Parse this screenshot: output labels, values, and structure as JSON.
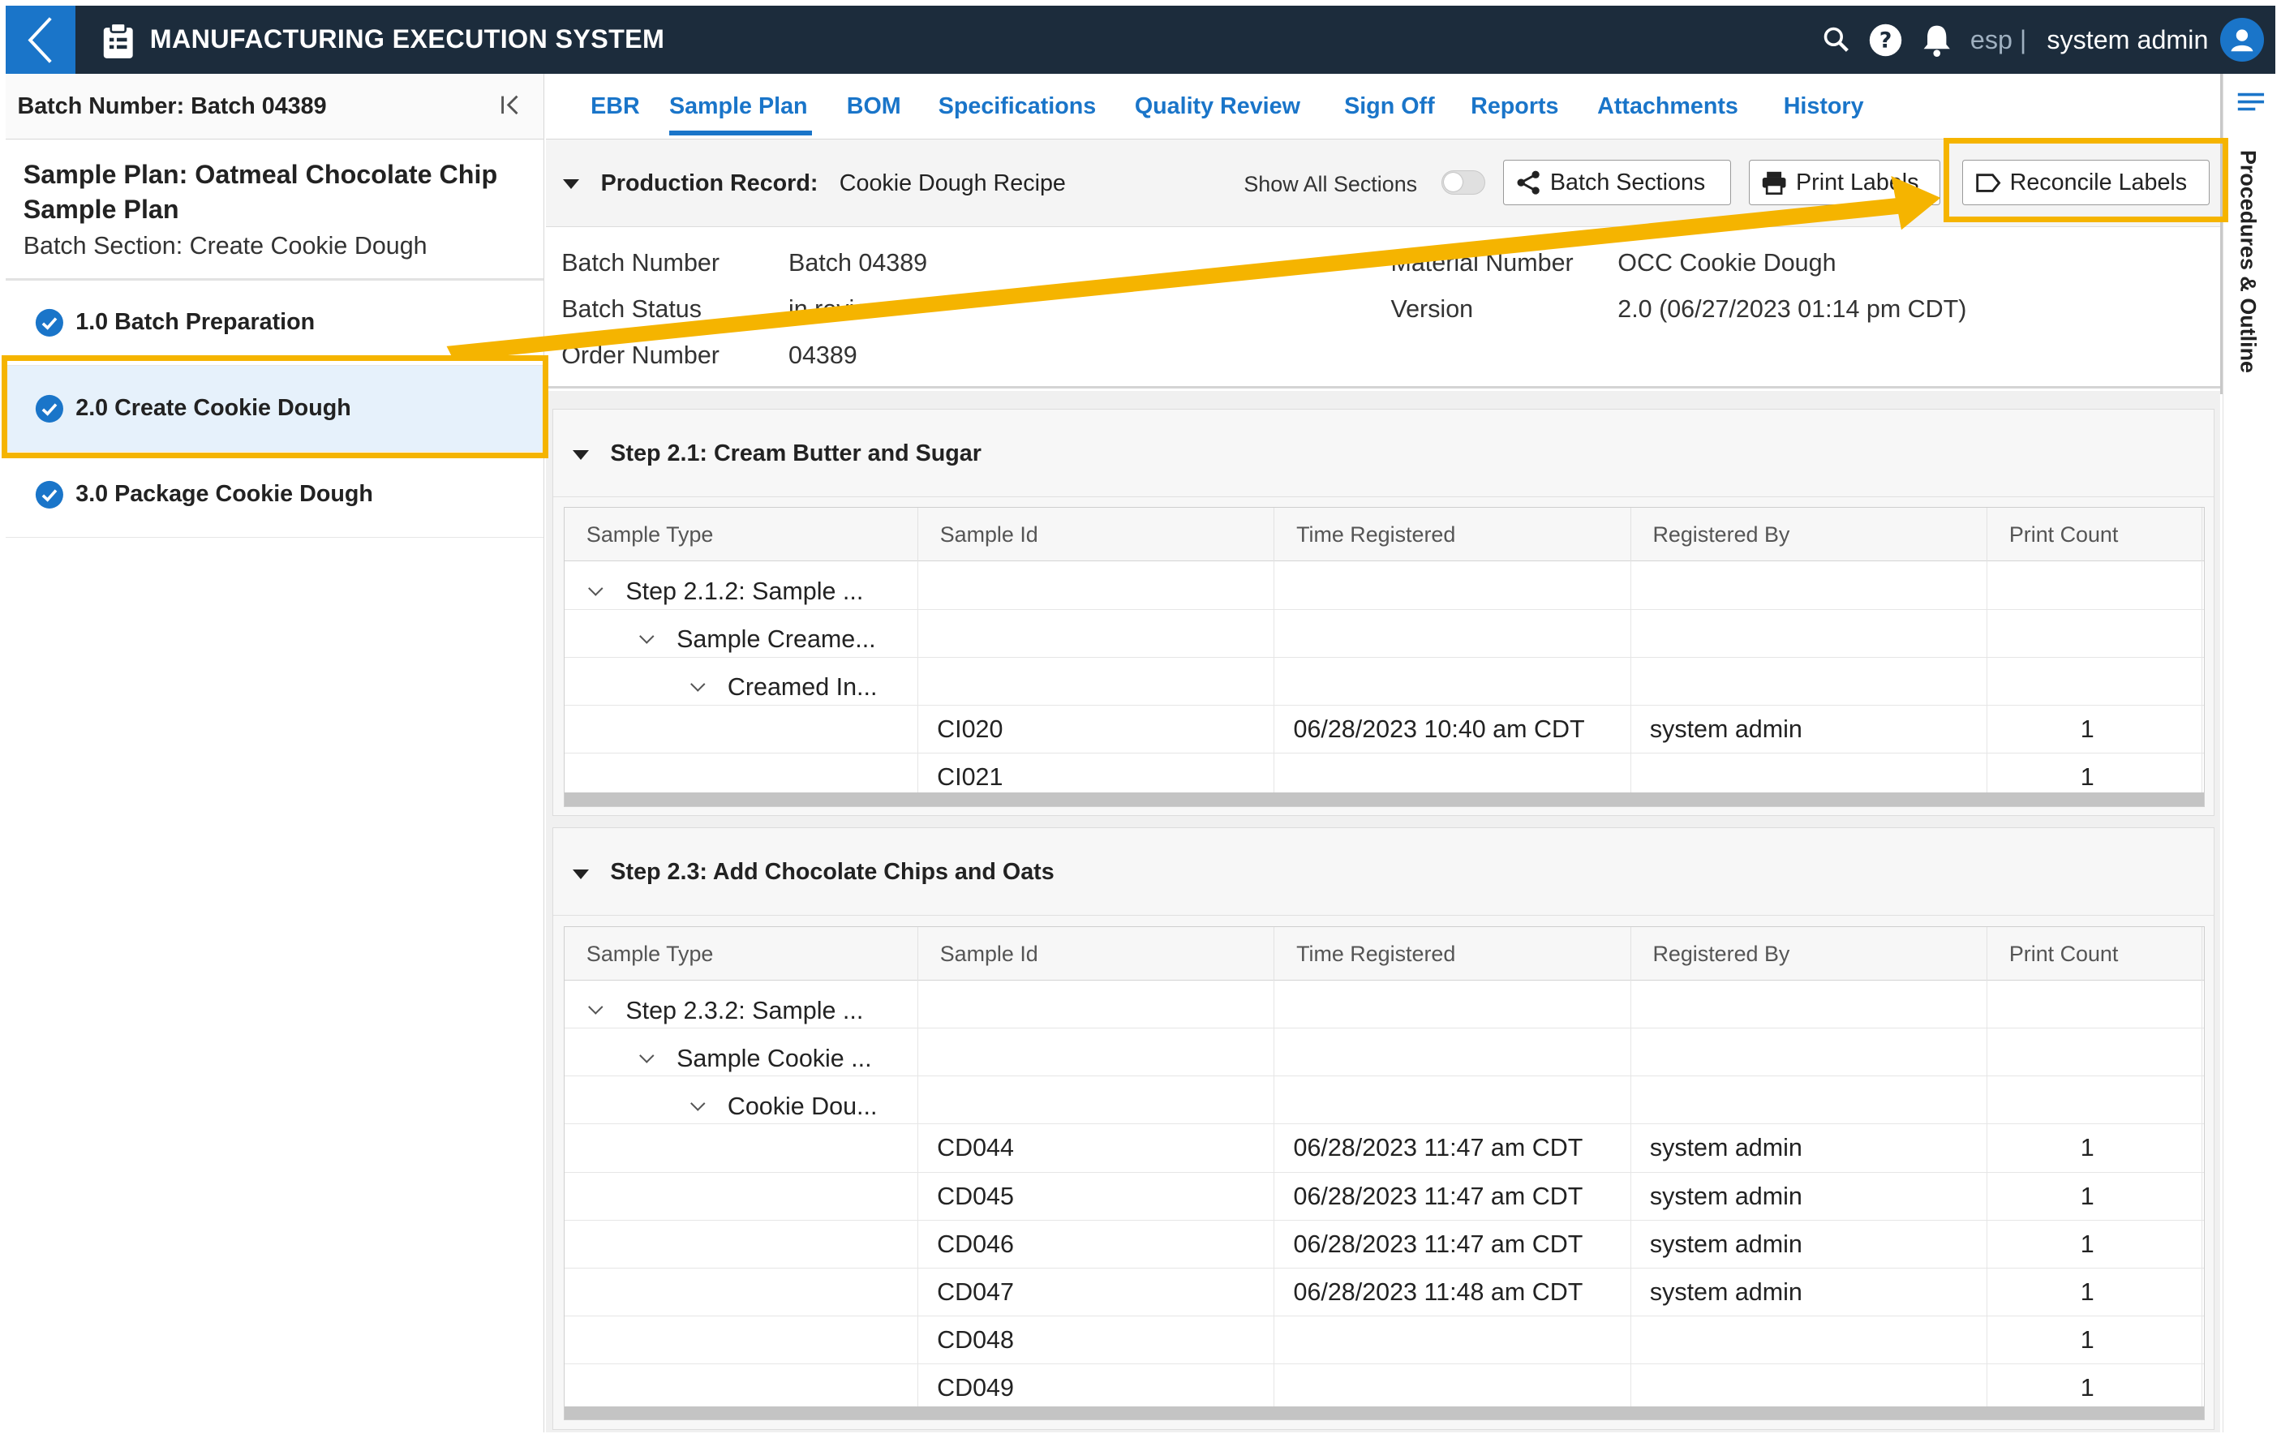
{
  "header": {
    "app_title": "MANUFACTURING EXECUTION SYSTEM",
    "language": "esp |",
    "user_name": "system admin"
  },
  "sidebar": {
    "batch_label": "Batch Number: Batch 04389",
    "plan_title": "Sample Plan: Oatmeal Chocolate Chip Sample Plan",
    "batch_section": "Batch Section: Create Cookie Dough",
    "items": [
      {
        "label": "1.0 Batch Preparation",
        "completed": true
      },
      {
        "label": "2.0 Create Cookie Dough",
        "completed": true,
        "active": true
      },
      {
        "label": "3.0 Package Cookie Dough",
        "completed": true
      }
    ]
  },
  "tabs": [
    "EBR",
    "Sample Plan",
    "BOM",
    "Specifications",
    "Quality Review",
    "Sign Off",
    "Reports",
    "Attachments",
    "History"
  ],
  "active_tab": "Sample Plan",
  "right_rail": {
    "label": "Procedures & Outline"
  },
  "production_record": {
    "title": "Production Record:",
    "recipe": "Cookie Dough Recipe",
    "show_all_sections": "Show All Sections",
    "show_all_sections_on": false,
    "buttons": {
      "batch_sections": "Batch Sections",
      "print_labels": "Print Labels",
      "reconcile_labels": "Reconcile Labels"
    }
  },
  "info": {
    "batch_number_label": "Batch Number",
    "batch_number": "Batch 04389",
    "batch_status_label": "Batch Status",
    "batch_status": "in review",
    "order_number_label": "Order Number",
    "order_number": "04389",
    "material_number_label": "Material Number",
    "material_number": "OCC Cookie Dough",
    "version_label": "Version",
    "version": "2.0 (06/27/2023 01:14 pm CDT)"
  },
  "columns": [
    "Sample Type",
    "Sample Id",
    "Time Registered",
    "Registered By",
    "Print Count"
  ],
  "steps": [
    {
      "title": "Step 2.1: Cream Butter and Sugar",
      "tree": [
        "Step 2.1.2: Sample ...",
        "Sample Creame...",
        "Creamed In..."
      ],
      "rows": [
        {
          "id": "CI020",
          "time": "06/28/2023 10:40 am CDT",
          "by": "system admin",
          "count": "1"
        },
        {
          "id": "CI021",
          "time": "",
          "by": "",
          "count": "1"
        }
      ]
    },
    {
      "title": "Step 2.3: Add Chocolate Chips and Oats",
      "tree": [
        "Step 2.3.2: Sample ...",
        "Sample Cookie ...",
        "Cookie Dou..."
      ],
      "rows": [
        {
          "id": "CD044",
          "time": "06/28/2023 11:47 am CDT",
          "by": "system admin",
          "count": "1"
        },
        {
          "id": "CD045",
          "time": "06/28/2023 11:47 am CDT",
          "by": "system admin",
          "count": "1"
        },
        {
          "id": "CD046",
          "time": "06/28/2023 11:47 am CDT",
          "by": "system admin",
          "count": "1"
        },
        {
          "id": "CD047",
          "time": "06/28/2023 11:48 am CDT",
          "by": "system admin",
          "count": "1"
        },
        {
          "id": "CD048",
          "time": "",
          "by": "",
          "count": "1"
        },
        {
          "id": "CD049",
          "time": "",
          "by": "",
          "count": "1"
        }
      ]
    }
  ],
  "colors": {
    "topbar": "#1c2c3c",
    "accent": "#1a75c9",
    "highlight": "#f5b400",
    "active_row": "#e6f1fb"
  }
}
